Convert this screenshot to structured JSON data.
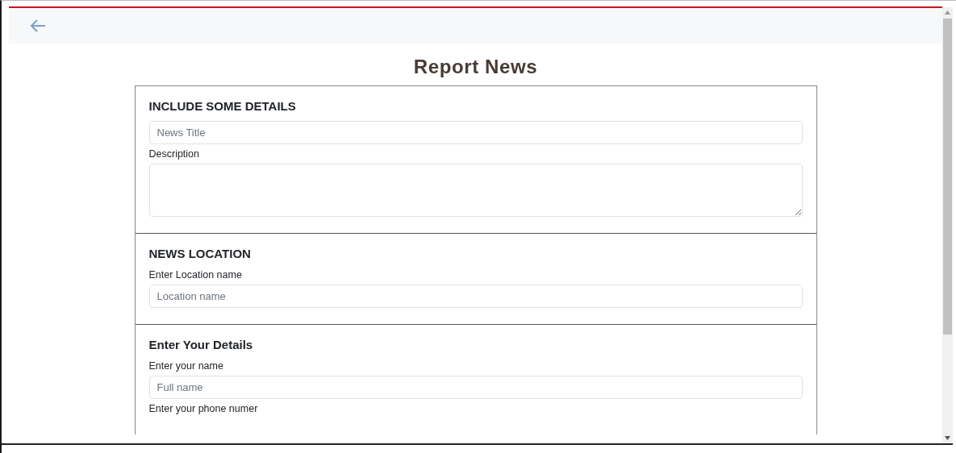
{
  "title": "Report News",
  "sections": [
    {
      "heading": "INCLUDE SOME DETAILS",
      "fields": [
        {
          "kind": "input",
          "placeholder": "News Title"
        },
        {
          "kind": "label",
          "text": "Description"
        },
        {
          "kind": "textarea"
        }
      ]
    },
    {
      "heading": "NEWS LOCATION",
      "fields": [
        {
          "kind": "label",
          "text": "Enter Location name"
        },
        {
          "kind": "input",
          "placeholder": "Location name"
        }
      ]
    },
    {
      "heading": "Enter Your Details",
      "fields": [
        {
          "kind": "label",
          "text": "Enter your name"
        },
        {
          "kind": "input",
          "placeholder": "Full name"
        },
        {
          "kind": "label",
          "text": "Enter your phone numer"
        }
      ]
    }
  ]
}
